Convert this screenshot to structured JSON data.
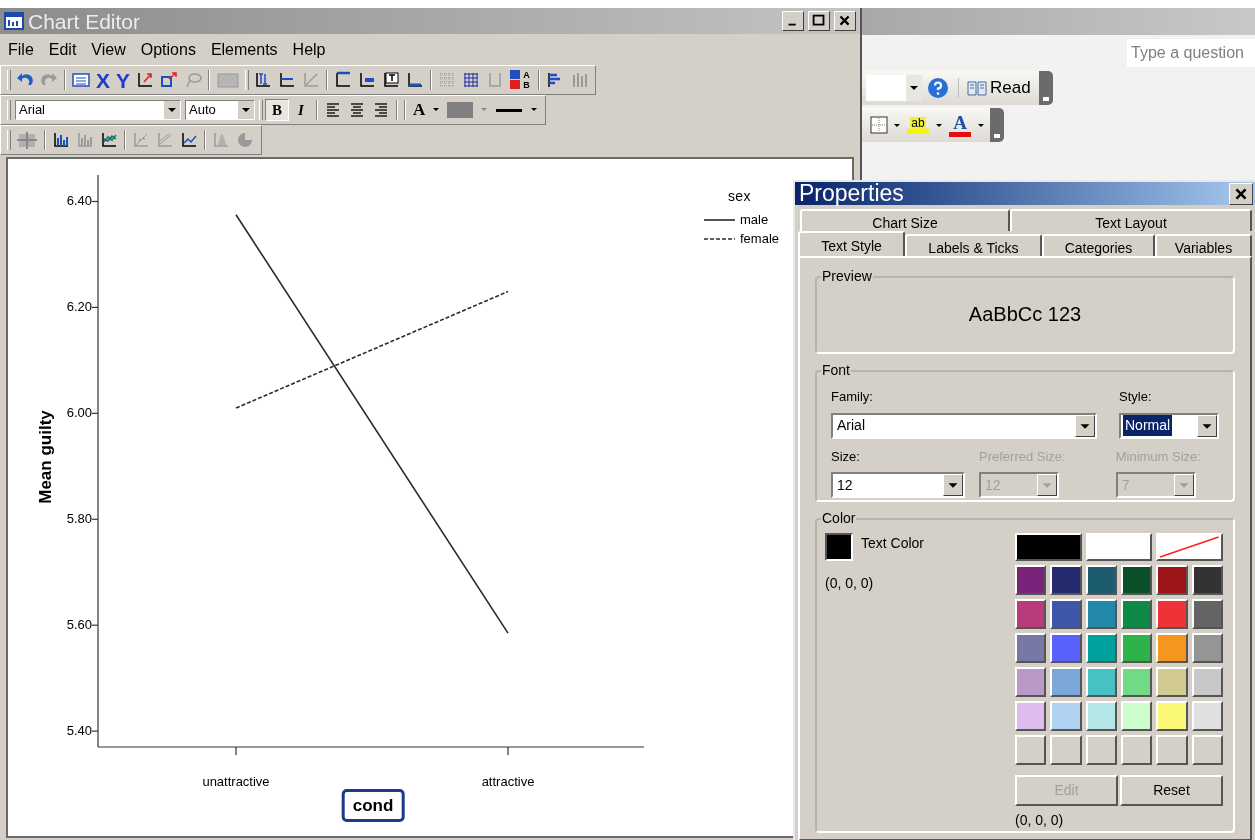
{
  "chart_editor": {
    "title": "Chart Editor",
    "menu": [
      "File",
      "Edit",
      "View",
      "Options",
      "Elements",
      "Help"
    ],
    "toolbar_letters": [
      "X",
      "Y",
      "A",
      "B"
    ],
    "format_toolbar": {
      "font": "Arial",
      "size": "Auto",
      "bold": {
        "label": "B",
        "selected": true
      },
      "italic": {
        "label": "I",
        "selected": false
      },
      "text_color": "A"
    },
    "chart": {
      "xlabel_selected": true,
      "chart_data": {
        "type": "line",
        "xlabel": "cond",
        "ylabel": "Mean guilty",
        "categories": [
          "unattractive",
          "attractive"
        ],
        "legend": {
          "title": "sex"
        },
        "series": [
          {
            "name": "male",
            "color": "#2b2b2b",
            "line_style": "solid",
            "values": [
              6.375,
              5.585
            ]
          },
          {
            "name": "female",
            "color": "#2b2b2b",
            "line_style": "dashed",
            "values": [
              6.01,
              6.23
            ]
          }
        ],
        "ylim": [
          5.37,
          6.45
        ],
        "yticks": [
          {
            "value": 5.4,
            "label": "5.40"
          },
          {
            "value": 5.6,
            "label": "5.60"
          },
          {
            "value": 5.8,
            "label": "5.80"
          },
          {
            "value": 6.0,
            "label": "6.00"
          },
          {
            "value": 6.2,
            "label": "6.20"
          },
          {
            "value": 6.4,
            "label": "6.40"
          }
        ]
      }
    }
  },
  "word": {
    "help_search": {
      "placeholder": "Type a question"
    },
    "read_button": "Read",
    "highlight": "ab",
    "font_color": "A"
  },
  "properties": {
    "title": "Properties",
    "tab_rows": [
      [
        {
          "label": "Chart Size",
          "selected": false
        },
        {
          "label": "Text Layout",
          "selected": false
        }
      ],
      [
        {
          "label": "Text Style",
          "selected": true
        },
        {
          "label": "Labels & Ticks",
          "selected": false
        },
        {
          "label": "Categories",
          "selected": false
        },
        {
          "label": "Variables",
          "selected": false
        }
      ]
    ],
    "preview": {
      "label": "Preview",
      "sample": "AaBbCc 123"
    },
    "font": {
      "label": "Font",
      "family": {
        "label": "Family:",
        "value": "Arial",
        "disabled": false,
        "highlighted": false
      },
      "style": {
        "label": "Style:",
        "value": "Normal",
        "disabled": false,
        "highlighted": true
      },
      "size": {
        "label": "Size:",
        "value": "12",
        "disabled": false,
        "highlighted": false
      },
      "preferred_size": {
        "label": "Preferred Size:",
        "value": "12",
        "disabled": true,
        "highlighted": false
      },
      "minimum_size": {
        "label": "Minimum Size:",
        "value": "7",
        "disabled": true,
        "highlighted": false
      }
    },
    "color": {
      "label": "Color",
      "target": {
        "label": "Text Color",
        "color": "#000000"
      },
      "rgb": "(0, 0, 0)",
      "presets": [
        {
          "kind": "swatch",
          "color": "#000000"
        },
        {
          "kind": "swatch",
          "color": "#ffffff"
        },
        {
          "kind": "none"
        }
      ],
      "palette": [
        {
          "kind": "swatch",
          "color": "#7b237b"
        },
        {
          "kind": "swatch",
          "color": "#262a6e"
        },
        {
          "kind": "swatch",
          "color": "#1d5b6e"
        },
        {
          "kind": "swatch",
          "color": "#0a5129"
        },
        {
          "kind": "swatch",
          "color": "#9e1518"
        },
        {
          "kind": "swatch",
          "color": "#333333"
        },
        {
          "kind": "swatch",
          "color": "#b93b7b"
        },
        {
          "kind": "swatch",
          "color": "#3f57a8"
        },
        {
          "kind": "swatch",
          "color": "#2389ab"
        },
        {
          "kind": "swatch",
          "color": "#0e8a47"
        },
        {
          "kind": "swatch",
          "color": "#ee3238"
        },
        {
          "kind": "swatch",
          "color": "#646464"
        },
        {
          "kind": "swatch",
          "color": "#7878a6"
        },
        {
          "kind": "swatch",
          "color": "#5a60fc"
        },
        {
          "kind": "swatch",
          "color": "#00a19d"
        },
        {
          "kind": "swatch",
          "color": "#2db34a"
        },
        {
          "kind": "swatch",
          "color": "#f7961f"
        },
        {
          "kind": "swatch",
          "color": "#959595"
        },
        {
          "kind": "swatch",
          "color": "#b899c8"
        },
        {
          "kind": "swatch",
          "color": "#7aa7d6"
        },
        {
          "kind": "swatch",
          "color": "#47c1c4"
        },
        {
          "kind": "swatch",
          "color": "#70db84"
        },
        {
          "kind": "swatch",
          "color": "#d1cb91"
        },
        {
          "kind": "swatch",
          "color": "#c8c8c8"
        },
        {
          "kind": "swatch",
          "color": "#dfbcef"
        },
        {
          "kind": "swatch",
          "color": "#aed2ef"
        },
        {
          "kind": "swatch",
          "color": "#b4e6e6"
        },
        {
          "kind": "swatch",
          "color": "#cdfccd"
        },
        {
          "kind": "swatch",
          "color": "#f9f877"
        },
        {
          "kind": "swatch",
          "color": "#e0e0e0"
        },
        {
          "kind": "empty"
        },
        {
          "kind": "empty"
        },
        {
          "kind": "empty"
        },
        {
          "kind": "empty"
        },
        {
          "kind": "empty"
        },
        {
          "kind": "empty"
        }
      ],
      "buttons": [
        {
          "label": "Edit",
          "disabled": true
        },
        {
          "label": "Reset",
          "disabled": false
        }
      ],
      "selected_rgb": "(0, 0, 0)"
    }
  }
}
